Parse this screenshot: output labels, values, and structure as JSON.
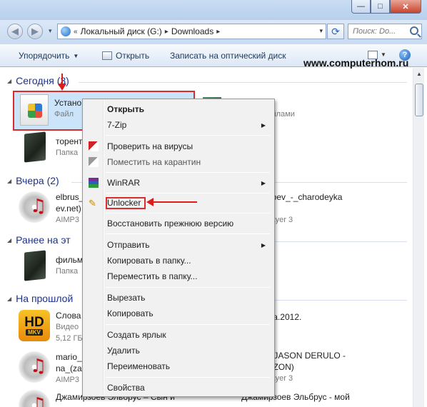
{
  "window": {
    "controls": [
      "—",
      "□",
      "✕"
    ]
  },
  "address": {
    "history_glyph": "▾",
    "prefix": "«",
    "crumbs": [
      "Локальный диск (G:)",
      "Downloads"
    ],
    "search_placeholder": "Поиск: Do..."
  },
  "toolbar": {
    "organize": "Упорядочить",
    "open": "Открыть",
    "burn": "Записать на оптический диск",
    "help": "?"
  },
  "watermark": "www.computerhom.ru",
  "groups": [
    {
      "label": "Сегодня (3)"
    },
    {
      "label": "Вчера (2)"
    },
    {
      "label": "Ранее на эт"
    },
    {
      "label": "На прошлой"
    }
  ],
  "files_left": [
    {
      "name": "Устано",
      "sub": "Файл"
    },
    {
      "name": "торент",
      "sub": "Папка"
    },
    {
      "name": "elbrus_",
      "sub2": "ev.net)",
      "sub": "AIMP3"
    },
    {
      "name": "фильм",
      "sub": "Папка"
    },
    {
      "name": "Слова",
      "sub2": "Видео",
      "sub": "5,12 ГБ",
      "hd_top": "HD",
      "hd_bottom": "MKV"
    },
    {
      "name": "mario_",
      "sub2": "na_(zay",
      "sub": "AIMP3"
    },
    {
      "name": "Джамирзоев Эльбрус – Сын и"
    }
  ],
  "files_right": [
    {
      "name": "te",
      "sub": "Файлами"
    },
    {
      "name": "hanmirzoev_-_charodeyka",
      "sub2": "ev.net)",
      "sub": "MPEG Layer 3"
    },
    {
      "name": "няя жена.2012."
    },
    {
      "name": "VATO & JASON DERULO -",
      "sub2": "R (BY OZON)",
      "sub": "MPEG Layer 3"
    },
    {
      "name": "Джамирзоев Эльбрус - мой"
    }
  ],
  "context_menu": {
    "open": "Открыть",
    "sevenzip": "7-Zip",
    "scan": "Проверить на вирусы",
    "quarantine": "Поместить на карантин",
    "winrar": "WinRAR",
    "unlocker": "Unlocker",
    "restore": "Восстановить прежнюю версию",
    "send_to": "Отправить",
    "copy_to": "Копировать в папку...",
    "move_to": "Переместить в папку...",
    "cut": "Вырезать",
    "copy": "Копировать",
    "shortcut": "Создать ярлык",
    "delete": "Удалить",
    "rename": "Переименовать",
    "properties": "Свойства"
  }
}
